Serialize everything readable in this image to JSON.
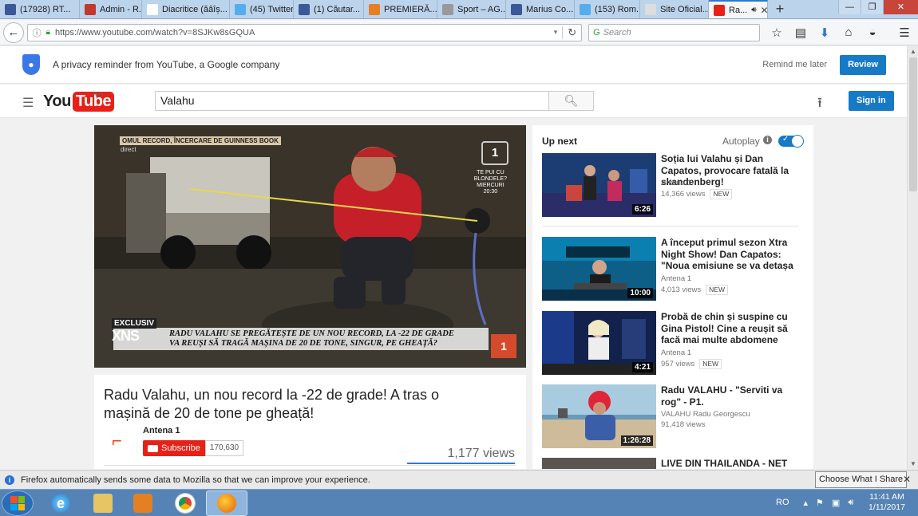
{
  "browser": {
    "tabs": [
      {
        "label": "(17928) RT...",
        "color": "#3b5998"
      },
      {
        "label": "Admin - R...",
        "color": "#c0392b"
      },
      {
        "label": "Diacritice (ăâîș...",
        "color": "#ffffff"
      },
      {
        "label": "(45) Twitter",
        "color": "#55acee"
      },
      {
        "label": "(1) Căutar...",
        "color": "#3b5998"
      },
      {
        "label": "PREMIERĂ...",
        "color": "#e67e22"
      },
      {
        "label": "Sport – AG...",
        "color": "#999999"
      },
      {
        "label": "Marius Co...",
        "color": "#3b5998"
      },
      {
        "label": "(153) Rom...",
        "color": "#55acee"
      },
      {
        "label": "Site Oficial...",
        "color": "#dddddd"
      },
      {
        "label": "Ra...",
        "color": "#e62117"
      }
    ],
    "new_tab": "+",
    "url": "https://www.youtube.com/watch?v=8SJKw8sGQUA",
    "search_placeholder": "Search"
  },
  "privacy": {
    "text": "A privacy reminder from YouTube, a Google company",
    "remind_label": "Remind me later",
    "review_label": "Review"
  },
  "masthead": {
    "logo_you": "You",
    "logo_tube": "Tube",
    "region": "RO",
    "search_value": "Valahu",
    "signin_label": "Sign in"
  },
  "player": {
    "top_banner": "OMUL RECORD, ÎNCERCARE DE GUINNESS BOOK",
    "direct": "direct",
    "channel_badge": "1",
    "promo": [
      "TE PUI CU",
      "BLONDELE?",
      "MIERCURI",
      "20:30"
    ],
    "exclusive": "EXCLUSIV",
    "xns": "XNS",
    "caption": [
      "RADU VALAHU SE PREGĂTEȘTE DE UN NOU RECORD, LA -22 DE GRADE",
      "VA REUȘI SĂ TRAGĂ MAȘINA DE 20 DE TONE, SINGUR, PE GHEAȚĂ?"
    ],
    "corner": "1"
  },
  "video": {
    "title": "Radu Valahu, un nou record la -22 de grade! A tras o mașină de 20 de tone pe gheață!",
    "channel": "Antena 1",
    "subscribe_label": "Subscribe",
    "subscriber_count": "170,630",
    "views": "1,177 views"
  },
  "sidebar": {
    "up_next": "Up next",
    "autoplay": "Autoplay",
    "autoplay_on": true,
    "items": [
      {
        "title": "Soția lui Valahu și Dan Capatos, provocare fatală la skandenberg!",
        "channel": "Antena 1",
        "views": "14,366 views",
        "badge": "NEW",
        "duration": "6:26"
      },
      {
        "title": "A început primul sezon Xtra Night Show! Dan Capatos: \"Noua emisiune se va detașa de tot ce a",
        "channel": "Antena 1",
        "views": "4,013 views",
        "badge": "NEW",
        "duration": "10:00"
      },
      {
        "title": "Probă de chin și suspine cu Gina Pistol! Cine a reușit să facă mai multe abdomene decât frumoa",
        "channel": "Antena 1",
        "views": "957 views",
        "badge": "NEW",
        "duration": "4:21"
      },
      {
        "title": "Radu VALAHU - \"Serviti va rog\" - P1.",
        "channel": "VALAHU Radu Georgescu",
        "views": "91,418 views",
        "badge": "",
        "duration": "1:26:28"
      },
      {
        "title": "LIVE DIN THAILANDA - NET",
        "channel": "",
        "views": "",
        "badge": "",
        "duration": ""
      }
    ]
  },
  "notification": {
    "text": "Firefox automatically sends some data to Mozilla so that we can improve your experience.",
    "button": "Choose What I Share"
  },
  "taskbar": {
    "lang": "RO",
    "time": "11:41 AM",
    "date": "1/11/2017"
  }
}
